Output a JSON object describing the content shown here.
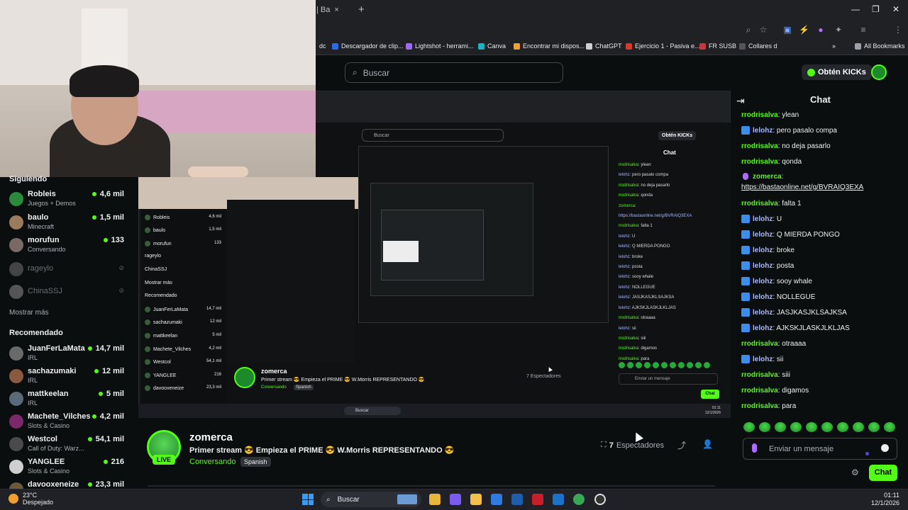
{
  "browser": {
    "tab_label": "| Ba",
    "tab_close": "×",
    "new_tab": "+",
    "bookmarks": [
      {
        "label": "Descargador de clip...",
        "color": "#2b6de0"
      },
      {
        "label": "Lightshot - herrami...",
        "color": "#9b6cf0"
      },
      {
        "label": "Canva",
        "color": "#19b3c4"
      },
      {
        "label": "Encontrar mi dispos...",
        "color": "#e9a23b"
      },
      {
        "label": "ChatGPT",
        "color": "#cfcfcf"
      },
      {
        "label": "Ejercicio 1 - Pasiva e...",
        "color": "#d63a2a"
      },
      {
        "label": "FR SUSB",
        "color": "#c23a3a"
      },
      {
        "label": "Collares d",
        "color": "#555555"
      }
    ],
    "all_bookmarks": "All Bookmarks",
    "chevron": "»"
  },
  "header": {
    "search_placeholder": "Buscar",
    "kicks_label": "Obtén KICKs"
  },
  "sidebar": {
    "following_title": "Siguiendo",
    "following": [
      {
        "name": "Robleis",
        "category": "Juegos + Demos",
        "viewers": "4,6 mil",
        "avatar": "#2c8a3a"
      },
      {
        "name": "baulo",
        "category": "Minecraft",
        "viewers": "1,5 mil",
        "avatar": "#9c7a5c"
      },
      {
        "name": "morufun",
        "category": "Conversando",
        "viewers": "133",
        "avatar": "#7a6a66"
      }
    ],
    "offline": [
      {
        "name": "rageylo",
        "avatar": "#444444"
      },
      {
        "name": "ChinaSSJ",
        "avatar": "#555555"
      }
    ],
    "show_more": "Mostrar más",
    "recommended_title": "Recomendado",
    "recommended": [
      {
        "name": "JuanFerLaMata",
        "category": "IRL",
        "viewers": "14,7 mil",
        "avatar": "#6a6a6a"
      },
      {
        "name": "sachazumaki",
        "category": "IRL",
        "viewers": "12 mil",
        "avatar": "#8a5a40"
      },
      {
        "name": "mattkeelan",
        "category": "IRL",
        "viewers": "5 mil",
        "avatar": "#5a6a7a"
      },
      {
        "name": "Machete_Vilches",
        "category": "Slots & Casino",
        "viewers": "4,2 mil",
        "avatar": "#7a2a6a"
      },
      {
        "name": "Westcol",
        "category": "Call of Duty: Warz...",
        "viewers": "54,1 mil",
        "avatar": "#4a4a4a"
      },
      {
        "name": "YANGLEE",
        "category": "Slots & Casino",
        "viewers": "216",
        "avatar": "#cfcfcf"
      },
      {
        "name": "davooxeneize",
        "category": "",
        "viewers": "23,3 mil",
        "avatar": "#6a5a3a"
      }
    ]
  },
  "stream": {
    "streamer": "zomerca",
    "live_badge": "LIVE",
    "title": "Primer stream 😎 Empieza el PRIME 😎 W.Morris REPRESENTANDO 😎",
    "category": "Conversando",
    "language": "Spanish",
    "viewers": "7",
    "viewers_label": "Espectadores"
  },
  "chat": {
    "title": "Chat",
    "messages": [
      {
        "user": "rrodrisalva",
        "text": "ylean",
        "color": "#53fc18",
        "badge": false
      },
      {
        "user": "lelohz",
        "text": "pero pasalo compa",
        "color": "#a8b8ff",
        "badge": true
      },
      {
        "user": "rrodrisalva",
        "text": "no deja pasarlo",
        "color": "#53fc18",
        "badge": false
      },
      {
        "user": "rrodrisalva",
        "text": "qonda",
        "color": "#53fc18",
        "badge": false
      }
    ],
    "link_message": {
      "user": "zomerca",
      "text": "https://bastaonline.net/g/BVRAIQ3EXA",
      "color": "#53fc18"
    },
    "messages2": [
      {
        "user": "rrodrisalva",
        "text": "falta 1",
        "color": "#53fc18",
        "badge": false
      },
      {
        "user": "lelohz",
        "text": "U",
        "color": "#a8b8ff",
        "badge": true
      },
      {
        "user": "lelohz",
        "text": "Q MIERDA PONGO",
        "color": "#a8b8ff",
        "badge": true
      },
      {
        "user": "lelohz",
        "text": "broke",
        "color": "#a8b8ff",
        "badge": true
      },
      {
        "user": "lelohz",
        "text": "posta",
        "color": "#a8b8ff",
        "badge": true
      },
      {
        "user": "lelohz",
        "text": "sooy whale",
        "color": "#a8b8ff",
        "badge": true
      },
      {
        "user": "lelohz",
        "text": "NOLLEGUE",
        "color": "#a8b8ff",
        "badge": true
      },
      {
        "user": "lelohz",
        "text": "JASJKASJKLSAJKSA",
        "color": "#a8b8ff",
        "badge": true
      },
      {
        "user": "lelohz",
        "text": "AJKSKJLASKJLKLJAS",
        "color": "#a8b8ff",
        "badge": true
      },
      {
        "user": "rrodrisalva",
        "text": "otraaaa",
        "color": "#53fc18",
        "badge": false
      },
      {
        "user": "lelohz",
        "text": "sii",
        "color": "#a8b8ff",
        "badge": true
      },
      {
        "user": "rrodrisalva",
        "text": "siii",
        "color": "#53fc18",
        "badge": false
      },
      {
        "user": "rrodrisalva",
        "text": "digamos",
        "color": "#53fc18",
        "badge": false
      },
      {
        "user": "rrodrisalva",
        "text": "para",
        "color": "#53fc18",
        "badge": false
      }
    ],
    "input_placeholder": "Enviar un mensaje",
    "send_label": "Chat"
  },
  "recursive": {
    "search": "Buscar",
    "kicks": "Obtén KICKs",
    "chat_title": "Chat",
    "lines": [
      {
        "u": "rrodrisalva",
        "t": "ylean"
      },
      {
        "u": "lelohz",
        "t": "pero pasalo compa"
      },
      {
        "u": "rrodrisalva",
        "t": "no deja pasarlo"
      },
      {
        "u": "rrodrisalva",
        "t": "qonda"
      },
      {
        "u": "zomerca",
        "t": ""
      },
      {
        "u": "",
        "t": "https://bastaonline.net/g/BVRAIQ3EXA"
      },
      {
        "u": "rrodrisalva",
        "t": "falta 1"
      },
      {
        "u": "lelohz",
        "t": "U"
      },
      {
        "u": "lelohz",
        "t": "Q MIERDA PONGO"
      },
      {
        "u": "lelohz",
        "t": "broke"
      },
      {
        "u": "lelohz",
        "t": "posta"
      },
      {
        "u": "lelohz",
        "t": "sooy whale"
      },
      {
        "u": "lelohz",
        "t": "NOLLEGUE"
      },
      {
        "u": "lelohz",
        "t": "JASJKASJKLSAJKSA"
      },
      {
        "u": "lelohz",
        "t": "AJKSKJLASKJLKLJAS"
      },
      {
        "u": "rrodrisalva",
        "t": "otraaaa"
      },
      {
        "u": "lelohz",
        "t": "sii"
      },
      {
        "u": "rrodrisalva",
        "t": "siii"
      },
      {
        "u": "rrodrisalva",
        "t": "digamos"
      },
      {
        "u": "rrodrisalva",
        "t": "para"
      }
    ],
    "sidebar": [
      {
        "n": "Siguiendo",
        "v": ""
      },
      {
        "n": "Robleis",
        "v": "4,6 mil"
      },
      {
        "n": "baulo",
        "v": "1,5 mil"
      },
      {
        "n": "morufun",
        "v": "133"
      },
      {
        "n": "rageylo",
        "v": ""
      },
      {
        "n": "ChinaSSJ",
        "v": ""
      },
      {
        "n": "Mostrar más",
        "v": ""
      },
      {
        "n": "Recomendado",
        "v": ""
      },
      {
        "n": "JuanFerLaMata",
        "v": "14,7 mil"
      },
      {
        "n": "sachazumaki",
        "v": "12 mil"
      },
      {
        "n": "mattkeelan",
        "v": "5 mil"
      },
      {
        "n": "Machete_Vilches",
        "v": "4,2 mil"
      },
      {
        "n": "Westcol",
        "v": "54,1 mil"
      },
      {
        "n": "YANGLEE",
        "v": "216"
      },
      {
        "n": "davooxeneize",
        "v": "23,3 mil"
      }
    ],
    "streamer": "zomerca",
    "title": "Primer stream 😎 Empieza el PRIME 😎 W.Morris REPRESENTANDO 😎",
    "category": "Conversando",
    "language": "Spanish",
    "spectators": "7 Espectadores",
    "input": "Enviar un mensaje",
    "send": "Chat",
    "taskbar_search": "Buscar",
    "clock_time": "01:11",
    "clock_date": "12/1/2026"
  },
  "taskbar": {
    "temperature": "23°C",
    "weather": "Despejado",
    "search": "Buscar",
    "apps": [
      {
        "name": "file-explorer-icon",
        "color": "#e9b43b"
      },
      {
        "name": "copilot-icon",
        "color": "#7a5cf0"
      },
      {
        "name": "folder-icon",
        "color": "#f3c04a"
      },
      {
        "name": "store-icon",
        "color": "#2f7be0"
      },
      {
        "name": "dell-icon",
        "color": "#1b5fae"
      },
      {
        "name": "mcafee-icon",
        "color": "#c8202a"
      },
      {
        "name": "outlook-icon",
        "color": "#1a73c8"
      },
      {
        "name": "chrome-icon",
        "color": "#3aa757"
      },
      {
        "name": "obs-icon",
        "color": "#333333"
      }
    ],
    "time": "01:11",
    "date": "12/1/2026"
  }
}
